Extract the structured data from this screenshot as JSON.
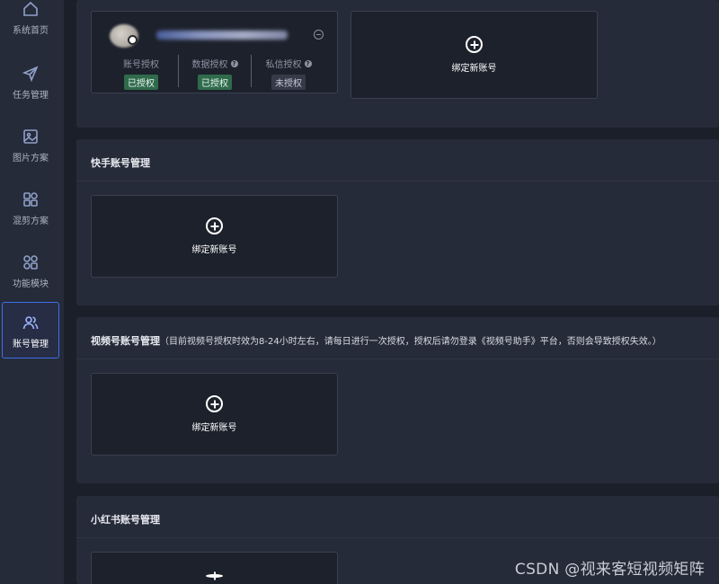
{
  "sidebar": {
    "items": [
      {
        "label": "系统首页",
        "icon": "home-icon"
      },
      {
        "label": "任务管理",
        "icon": "send-icon"
      },
      {
        "label": "图片方案",
        "icon": "image-icon"
      },
      {
        "label": "混剪方案",
        "icon": "grid-icon"
      },
      {
        "label": "功能模块",
        "icon": "apps-icon"
      },
      {
        "label": "账号管理",
        "icon": "users-icon",
        "active": true
      }
    ]
  },
  "douyin": {
    "account": {
      "auth": [
        {
          "label": "账号授权",
          "status": "已授权"
        },
        {
          "label": "数据授权",
          "status": "已授权"
        },
        {
          "label": "私信授权",
          "status": "未授权"
        }
      ]
    },
    "bind_label": "绑定新账号"
  },
  "kuaishou": {
    "title": "快手账号管理",
    "bind_label": "绑定新账号"
  },
  "shipinhao": {
    "title": "视频号账号管理",
    "note": "（目前视频号授权时效为8-24小时左右，请每日进行一次授权，授权后请勿登录《视频号助手》平台，否则会导致授权失效。）",
    "bind_label": "绑定新账号"
  },
  "xiaohongshu": {
    "title": "小红书账号管理"
  },
  "watermark": "CSDN @视来客短视频矩阵",
  "colors": {
    "active_border": "#3f6fe8",
    "authorized_badge": "#2f6b4b",
    "panel": "#262b39",
    "background": "#1b1f2a"
  }
}
